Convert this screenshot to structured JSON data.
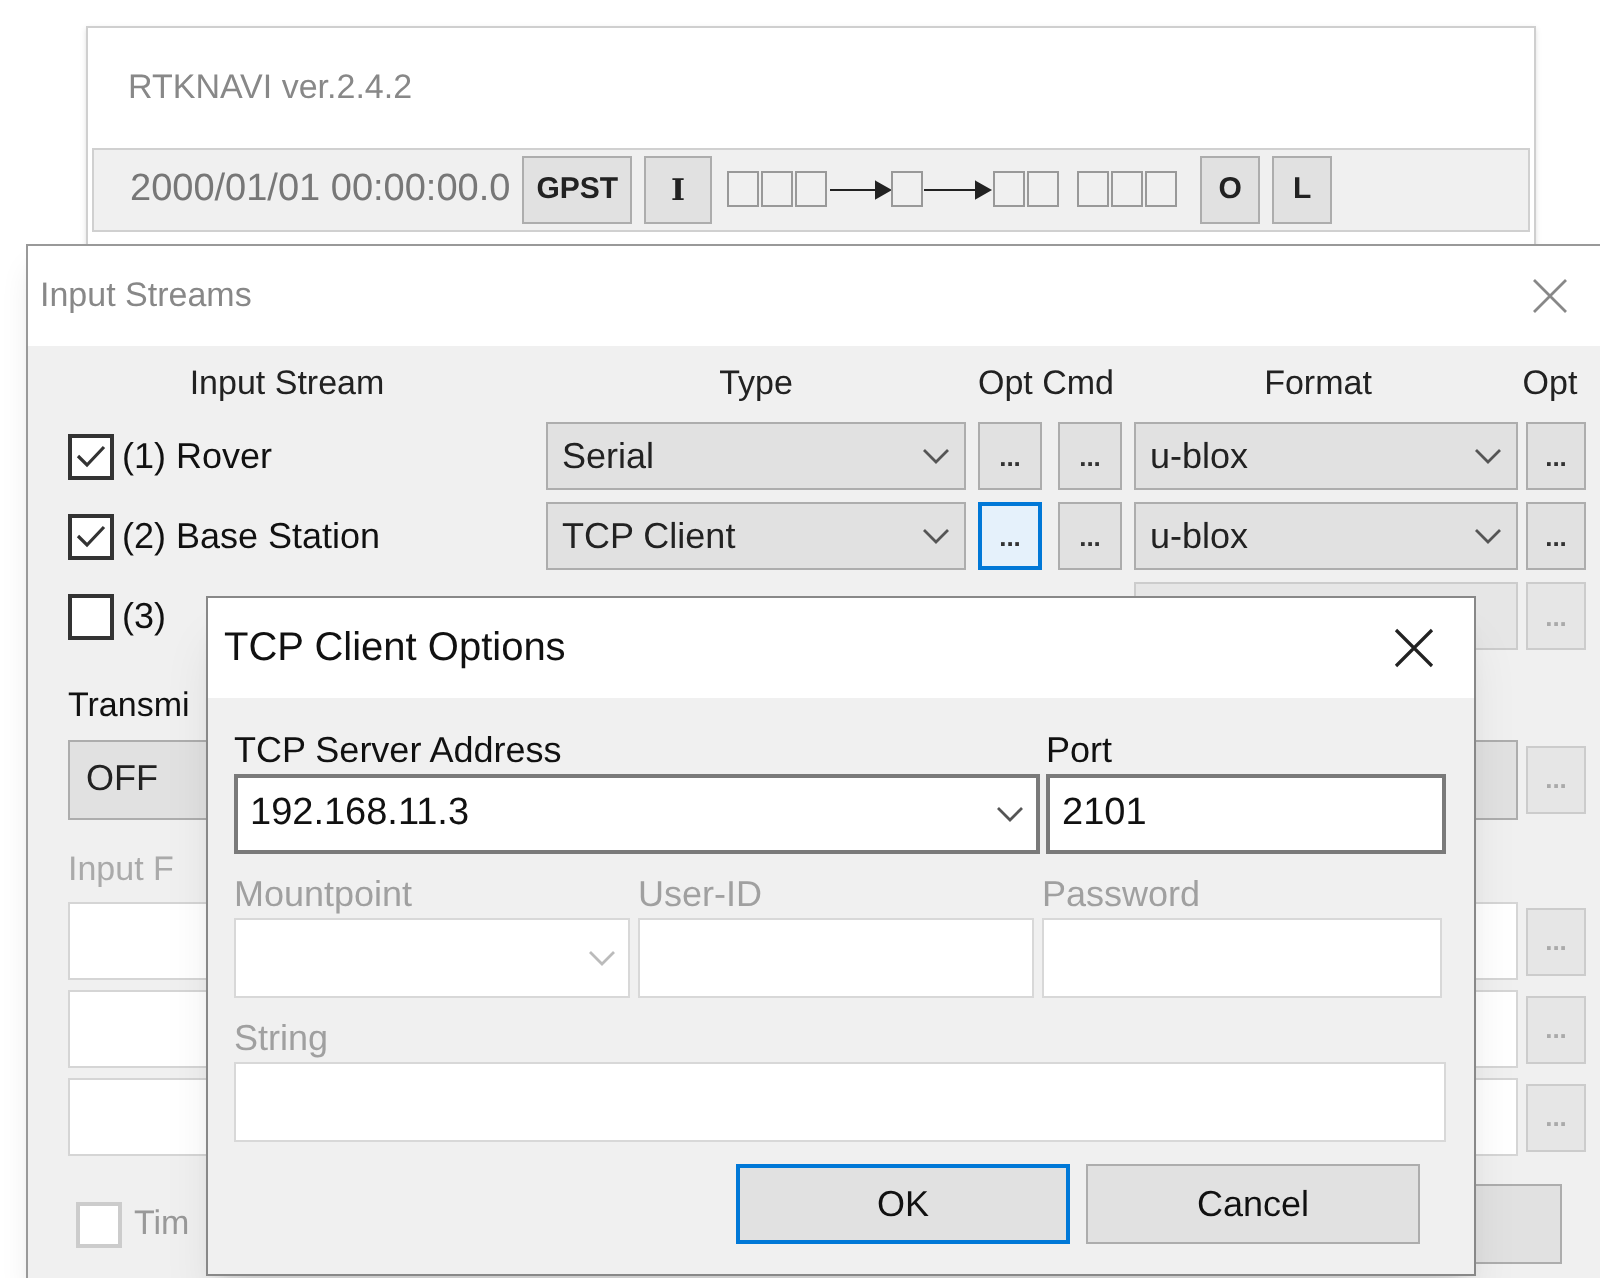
{
  "main_window": {
    "title": "RTKNAVI ver.2.4.2",
    "time": "2000/01/01 00:00:00.0",
    "time_button": "GPST",
    "info_button": "I",
    "right_buttons": [
      "O",
      "L"
    ]
  },
  "input_streams": {
    "title": "Input Streams",
    "columns": [
      "Input Stream",
      "Type",
      "Opt Cmd",
      "Format",
      "Opt"
    ],
    "rows": [
      {
        "label": "(1) Rover",
        "checked": true,
        "type": "Serial",
        "opt_button": "...",
        "cmd_button": "...",
        "format": "u-blox",
        "format_opt_button": "...",
        "opt_focused": false,
        "disabled": false
      },
      {
        "label": "(2) Base Station",
        "checked": true,
        "type": "TCP Client",
        "opt_button": "...",
        "cmd_button": "...",
        "format": "u-blox",
        "format_opt_button": "...",
        "opt_focused": true,
        "disabled": false
      },
      {
        "label": "(3)",
        "checked": false,
        "format_opt_button": "...",
        "disabled": true
      }
    ],
    "transmit": {
      "label": "Transmi",
      "value": "OFF",
      "option_button": "..."
    },
    "input_files": {
      "label": "Input F",
      "rows": [
        {
          "option_button": "..."
        },
        {
          "option_button": "..."
        },
        {
          "option_button": "..."
        }
      ]
    },
    "time_option": {
      "label": "Tim",
      "checked": false
    }
  },
  "tcp_dialog": {
    "title": "TCP Client Options",
    "fields": [
      {
        "label": "TCP Server Address",
        "value": "192.168.11.3",
        "kind": "combo",
        "disabled": false
      },
      {
        "label": "Port",
        "value": "2101",
        "kind": "text",
        "disabled": false
      },
      {
        "label": "Mountpoint",
        "kind": "combo",
        "disabled": true
      },
      {
        "label": "User-ID",
        "kind": "text",
        "disabled": true
      },
      {
        "label": "Password",
        "kind": "text",
        "disabled": true
      },
      {
        "label": "String",
        "kind": "text",
        "disabled": true
      }
    ],
    "buttons": [
      {
        "label": "OK",
        "default": true
      },
      {
        "label": "Cancel",
        "default": false
      }
    ]
  }
}
